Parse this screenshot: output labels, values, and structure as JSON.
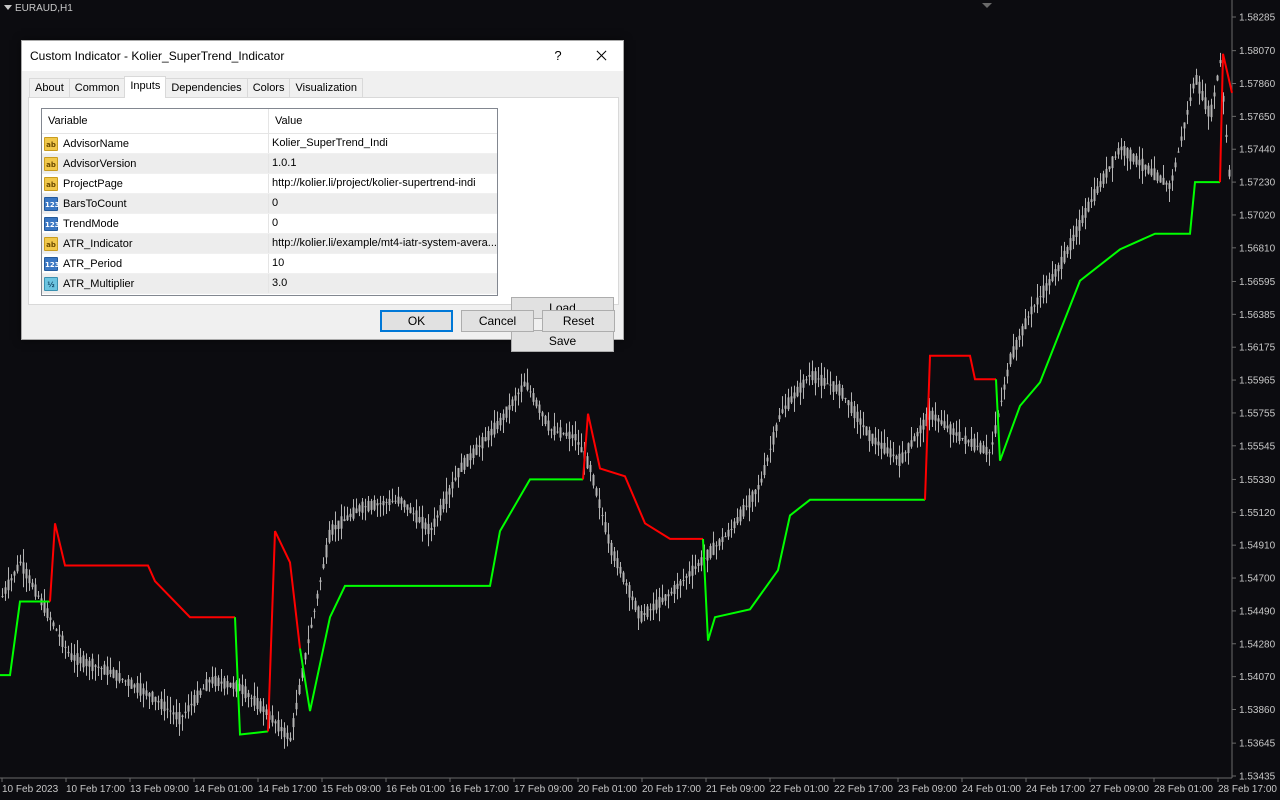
{
  "chart": {
    "symbol": "EURAUD,H1",
    "background": "#0c0c10",
    "candle_color": "#b4b4b4",
    "trend_up_color": "#00ff00",
    "trend_down_color": "#ff0000",
    "ylim": [
      1.53435,
      1.58285
    ],
    "price_ticks": [
      "1.58285",
      "1.58070",
      "1.57860",
      "1.57650",
      "1.57440",
      "1.57230",
      "1.57020",
      "1.56810",
      "1.56595",
      "1.56385",
      "1.56175",
      "1.55965",
      "1.55755",
      "1.55545",
      "1.55330",
      "1.55120",
      "1.54910",
      "1.54700",
      "1.54490",
      "1.54280",
      "1.54070",
      "1.53860",
      "1.53645",
      "1.53435"
    ],
    "time_ticks": [
      "10 Feb 2023",
      "10 Feb 17:00",
      "13 Feb 09:00",
      "14 Feb 01:00",
      "14 Feb 17:00",
      "15 Feb 09:00",
      "16 Feb 01:00",
      "16 Feb 17:00",
      "17 Feb 09:00",
      "20 Feb 01:00",
      "20 Feb 17:00",
      "21 Feb 09:00",
      "22 Feb 01:00",
      "22 Feb 17:00",
      "23 Feb 09:00",
      "24 Feb 01:00",
      "24 Feb 17:00",
      "27 Feb 09:00",
      "28 Feb 01:00",
      "28 Feb 17:00"
    ]
  },
  "dialog": {
    "title": "Custom Indicator - Kolier_SuperTrend_Indicator",
    "help": "?",
    "tabs": [
      "About",
      "Common",
      "Inputs",
      "Dependencies",
      "Colors",
      "Visualization"
    ],
    "active_tab": "Inputs",
    "columns": {
      "variable": "Variable",
      "value": "Value"
    },
    "params": [
      {
        "icon": "ab",
        "type": "string",
        "name": "AdvisorName",
        "value": "Kolier_SuperTrend_Indi"
      },
      {
        "icon": "ab",
        "type": "string",
        "name": "AdvisorVersion",
        "value": "1.0.1"
      },
      {
        "icon": "ab",
        "type": "string",
        "name": "ProjectPage",
        "value": "http://kolier.li/project/kolier-supertrend-indi"
      },
      {
        "icon": "123",
        "type": "int",
        "name": "BarsToCount",
        "value": "0"
      },
      {
        "icon": "123",
        "type": "int",
        "name": "TrendMode",
        "value": "0"
      },
      {
        "icon": "ab",
        "type": "string",
        "name": "ATR_Indicator",
        "value": "http://kolier.li/example/mt4-iatr-system-avera..."
      },
      {
        "icon": "123",
        "type": "int",
        "name": "ATR_Period",
        "value": "10"
      },
      {
        "icon": "½",
        "type": "double",
        "name": "ATR_Multiplier",
        "value": "3.0"
      }
    ],
    "buttons": {
      "load": "Load",
      "save": "Save",
      "ok": "OK",
      "cancel": "Cancel",
      "reset": "Reset"
    }
  }
}
